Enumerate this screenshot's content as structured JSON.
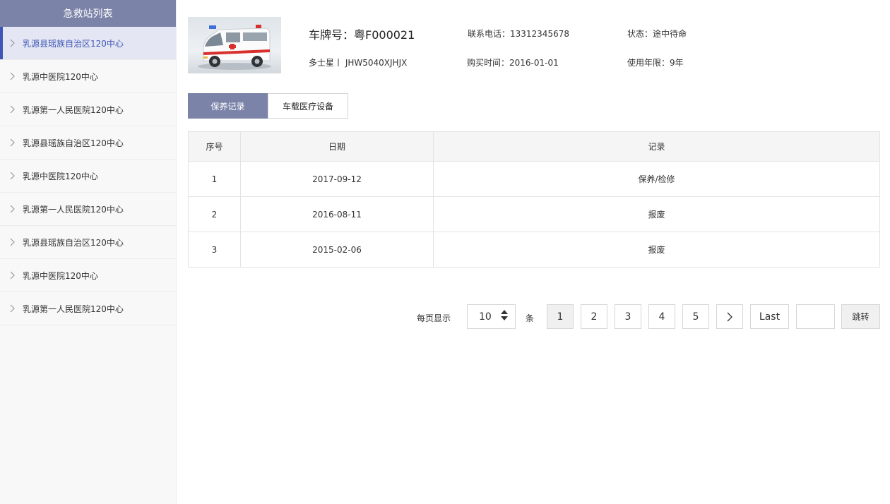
{
  "sidebar": {
    "title": "急救站列表",
    "items": [
      {
        "label": "乳源县瑶族自治区120中心"
      },
      {
        "label": "乳源中医院120中心"
      },
      {
        "label": "乳源第一人民医院120中心"
      },
      {
        "label": "乳源县瑶族自治区120中心"
      },
      {
        "label": "乳源中医院120中心"
      },
      {
        "label": "乳源第一人民医院120中心"
      },
      {
        "label": "乳源县瑶族自治区120中心"
      },
      {
        "label": "乳源中医院120中心"
      },
      {
        "label": "乳源第一人民医院120中心"
      }
    ]
  },
  "vehicle": {
    "plate": "车牌号：粤F000021",
    "phone": "联系电话：13312345678",
    "status": "状态：途中待命",
    "model": "多士星丨 JHW5040XJHJX",
    "purchase": "购买时间：2016-01-01",
    "years": "使用年限：9年"
  },
  "tabs": [
    {
      "label": "保养记录"
    },
    {
      "label": "车载医疗设备"
    }
  ],
  "table": {
    "headers": [
      "序号",
      "日期",
      "记录"
    ],
    "rows": [
      [
        "1",
        "2017-09-12",
        "保养/检修"
      ],
      [
        "2",
        "2016-08-11",
        "报废"
      ],
      [
        "3",
        "2015-02-06",
        "报废"
      ]
    ]
  },
  "pagination": {
    "per_page_label": "每页显示",
    "per_page_value": "10",
    "unit_label": "条",
    "pages": [
      "1",
      "2",
      "3",
      "4",
      "5"
    ],
    "last_label": "Last",
    "jump_label": "跳转"
  },
  "colors": {
    "accent": "#7b84a8",
    "active_text": "#3e56b5"
  }
}
